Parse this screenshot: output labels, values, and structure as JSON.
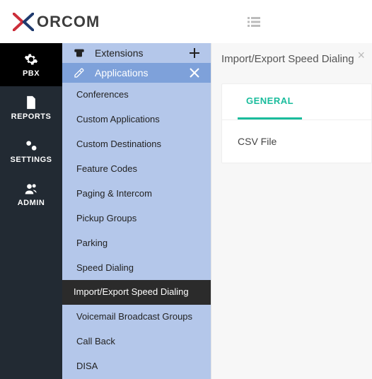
{
  "brand": {
    "name": "ORCOM"
  },
  "nav": {
    "items": [
      {
        "label": "PBX"
      },
      {
        "label": "REPORTS"
      },
      {
        "label": "SETTINGS"
      },
      {
        "label": "ADMIN"
      }
    ]
  },
  "panel": {
    "extensions_label": "Extensions",
    "applications_label": "Applications",
    "submenu": [
      "Conferences",
      "Custom Applications",
      "Custom Destinations",
      "Feature Codes",
      "Paging & Intercom",
      "Pickup Groups",
      "Parking",
      "Speed Dialing",
      "Import/Export Speed Dialing",
      "Voicemail Broadcast Groups",
      "Call Back",
      "DISA"
    ]
  },
  "content": {
    "title": "Import/Export Speed Dialing",
    "tab_general": "GENERAL",
    "field_csv": "CSV File"
  }
}
